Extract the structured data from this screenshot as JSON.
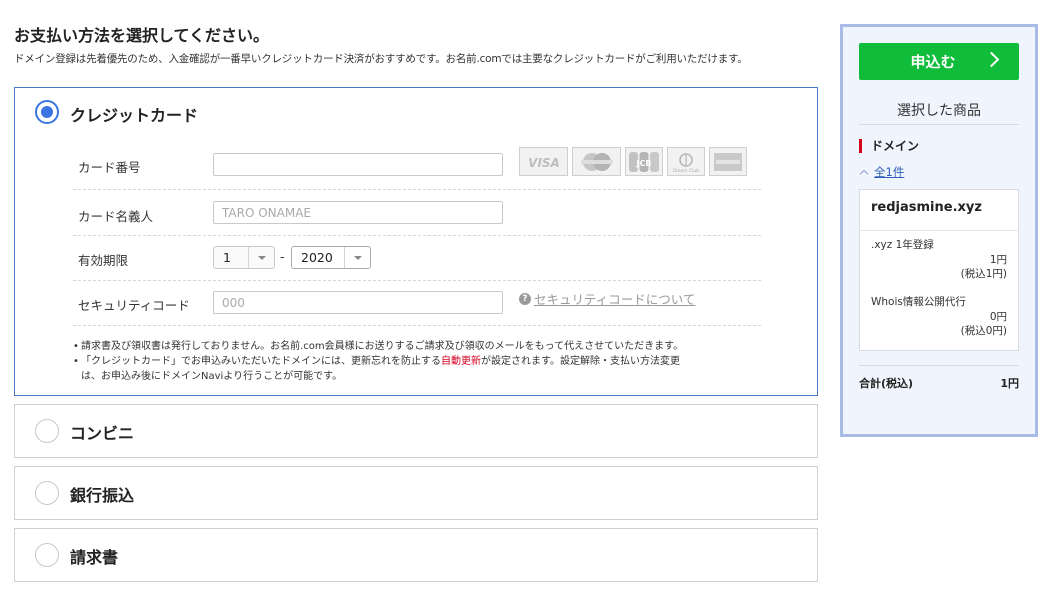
{
  "header": {
    "title": "お支払い方法を選択してください。",
    "description": "ドメイン登録は先着優先のため、入金確認が一番早いクレジットカード決済がおすすめです。お名前.comでは主要なクレジットカードがご利用いただけます。"
  },
  "payment_methods": {
    "credit_card": {
      "label": "クレジットカード",
      "selected": true,
      "card_number": {
        "label": "カード番号",
        "value": "",
        "placeholder": ""
      },
      "card_brands": [
        "VISA",
        "MasterCard",
        "JCB",
        "Diners Club",
        "American Express"
      ],
      "card_holder": {
        "label": "カード名義人",
        "placeholder": "TARO ONAMAE"
      },
      "expiry": {
        "label": "有効期限",
        "month": "1",
        "separator": "-",
        "year": "2020"
      },
      "security_code": {
        "label": "セキュリティコード",
        "placeholder": "000",
        "help_link": "セキュリティコードについて"
      },
      "notes": {
        "note1": "請求書及び領収書は発行しておりません。お名前.com会員様にお送りするご請求及び領収のメールをもって代えさせていただきます。",
        "note2_pre": "「クレジットカード」でお申込みいただいたドメインには、更新忘れを防止する",
        "note2_highlight": "自動更新",
        "note2_post": "が設定されます。設定解除・支払い方法変更",
        "note2_line2": "は、お申込み後にドメインNaviより行うことが可能です。"
      }
    },
    "convenience_store": {
      "label": "コンビニ",
      "selected": false
    },
    "bank_transfer": {
      "label": "銀行振込",
      "selected": false
    },
    "invoice": {
      "label": "請求書",
      "selected": false
    }
  },
  "sidebar": {
    "apply_button": "申込む",
    "title": "選択した商品",
    "section": "ドメイン",
    "all_link": "全1件",
    "item": {
      "name": "redjasmine.xyz",
      "line1_label": ".xyz 1年登録",
      "line1_price": "1円",
      "line1_tax": "(税込1円)",
      "line2_label": "Whois情報公開代行",
      "line2_price": "0円",
      "line2_tax": "(税込0円)"
    },
    "total_label": "合計(税込)",
    "total_value": "1円"
  },
  "colors": {
    "accent_blue": "#3a75e3",
    "apply_green": "#0fbd3a",
    "highlight_red": "#d4001e",
    "sidebar_border": "#a7bbe6"
  }
}
